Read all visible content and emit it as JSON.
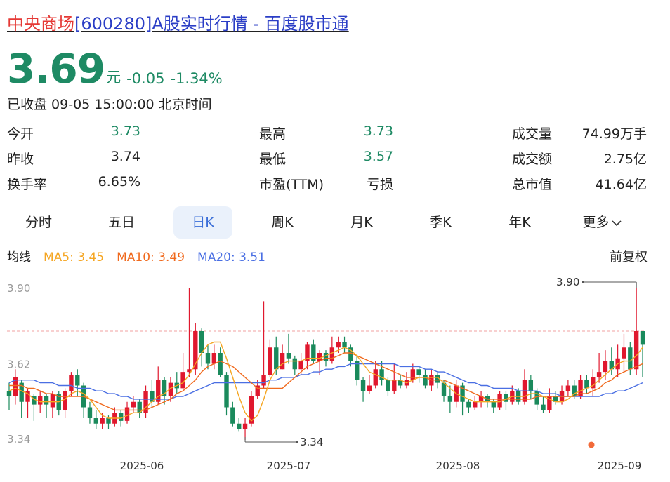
{
  "title": {
    "name": "中央商场",
    "rest": "[600280]A股实时行情 - 百度股市通"
  },
  "quote": {
    "price": "3.69",
    "unit": "元",
    "change": "-0.05",
    "change_pct": "-1.34%",
    "status": "已收盘 09-05 15:00:00 北京时间"
  },
  "stats": [
    [
      {
        "label": "今开",
        "value": "3.73",
        "tone": "green"
      },
      {
        "label": "最高",
        "value": "3.73",
        "tone": "green"
      },
      {
        "label": "成交量",
        "value": "74.99万手",
        "tone": "dark"
      }
    ],
    [
      {
        "label": "昨收",
        "value": "3.74",
        "tone": "dark"
      },
      {
        "label": "最低",
        "value": "3.57",
        "tone": "green"
      },
      {
        "label": "成交额",
        "value": "2.75亿",
        "tone": "dark"
      }
    ],
    [
      {
        "label": "换手率",
        "value": "6.65%",
        "tone": "dark"
      },
      {
        "label": "市盈(TTM)",
        "value": "亏损",
        "tone": "dark"
      },
      {
        "label": "总市值",
        "value": "41.64亿",
        "tone": "dark"
      }
    ]
  ],
  "tabs": [
    "分时",
    "五日",
    "日K",
    "周K",
    "月K",
    "季K",
    "年K",
    "更多"
  ],
  "active_tab": "日K",
  "ma": {
    "label": "均线",
    "ma5": "MA5: 3.45",
    "ma10": "MA10: 3.49",
    "ma20": "MA20: 3.51"
  },
  "adjust_label": "前复权",
  "colors": {
    "up": "#e0182e",
    "down": "#1a8a5c",
    "ma5": "#f5a623",
    "ma10": "#f06a1e",
    "ma20": "#4a6fe3",
    "ref_line": "#f2a1a1"
  },
  "chart_data": {
    "type": "candlestick",
    "y_ticks": [
      "3.90",
      "3.62",
      "3.34"
    ],
    "ylim": [
      3.34,
      3.9
    ],
    "x_ticks": [
      "2025-06",
      "2025-07",
      "2025-08",
      "2025-09"
    ],
    "high_label": "3.90",
    "low_label": "3.34",
    "prev_close": 3.74,
    "candles": [
      [
        3.52,
        3.5,
        3.55,
        3.45
      ],
      [
        3.5,
        3.57,
        3.6,
        3.47
      ],
      [
        3.55,
        3.48,
        3.56,
        3.42
      ],
      [
        3.48,
        3.52,
        3.53,
        3.42
      ],
      [
        3.5,
        3.47,
        3.51,
        3.41
      ],
      [
        3.47,
        3.5,
        3.52,
        3.44
      ],
      [
        3.5,
        3.47,
        3.51,
        3.42
      ],
      [
        3.46,
        3.51,
        3.52,
        3.42
      ],
      [
        3.51,
        3.45,
        3.52,
        3.43
      ],
      [
        3.45,
        3.52,
        3.53,
        3.42
      ],
      [
        3.52,
        3.58,
        3.59,
        3.5
      ],
      [
        3.58,
        3.54,
        3.6,
        3.5
      ],
      [
        3.54,
        3.46,
        3.55,
        3.42
      ],
      [
        3.46,
        3.42,
        3.48,
        3.4
      ],
      [
        3.42,
        3.4,
        3.45,
        3.38
      ],
      [
        3.4,
        3.42,
        3.44,
        3.38
      ],
      [
        3.42,
        3.4,
        3.43,
        3.38
      ],
      [
        3.4,
        3.44,
        3.46,
        3.39
      ],
      [
        3.44,
        3.41,
        3.45,
        3.39
      ],
      [
        3.41,
        3.46,
        3.48,
        3.4
      ],
      [
        3.46,
        3.48,
        3.5,
        3.44
      ],
      [
        3.48,
        3.44,
        3.49,
        3.42
      ],
      [
        3.44,
        3.52,
        3.54,
        3.42
      ],
      [
        3.52,
        3.48,
        3.56,
        3.46
      ],
      [
        3.48,
        3.56,
        3.61,
        3.47
      ],
      [
        3.56,
        3.5,
        3.57,
        3.47
      ],
      [
        3.5,
        3.55,
        3.57,
        3.48
      ],
      [
        3.55,
        3.53,
        3.59,
        3.51
      ],
      [
        3.53,
        3.59,
        3.66,
        3.52
      ],
      [
        3.59,
        3.6,
        3.9,
        3.57
      ],
      [
        3.6,
        3.74,
        3.77,
        3.58
      ],
      [
        3.74,
        3.66,
        3.75,
        3.61
      ],
      [
        3.66,
        3.62,
        3.69,
        3.6
      ],
      [
        3.62,
        3.66,
        3.69,
        3.6
      ],
      [
        3.66,
        3.58,
        3.68,
        3.57
      ],
      [
        3.58,
        3.46,
        3.59,
        3.43
      ],
      [
        3.46,
        3.4,
        3.48,
        3.39
      ],
      [
        3.4,
        3.38,
        3.42,
        3.37
      ],
      [
        3.38,
        3.4,
        3.42,
        3.34
      ],
      [
        3.4,
        3.5,
        3.52,
        3.39
      ],
      [
        3.5,
        3.54,
        3.56,
        3.49
      ],
      [
        3.54,
        3.58,
        3.85,
        3.53
      ],
      [
        3.58,
        3.68,
        3.71,
        3.57
      ],
      [
        3.68,
        3.6,
        3.72,
        3.58
      ],
      [
        3.6,
        3.66,
        3.69,
        3.6
      ],
      [
        3.66,
        3.64,
        3.73,
        3.62
      ],
      [
        3.64,
        3.6,
        3.65,
        3.58
      ],
      [
        3.6,
        3.63,
        3.66,
        3.58
      ],
      [
        3.63,
        3.69,
        3.7,
        3.6
      ],
      [
        3.69,
        3.63,
        3.71,
        3.62
      ],
      [
        3.63,
        3.66,
        3.67,
        3.58
      ],
      [
        3.66,
        3.63,
        3.67,
        3.61
      ],
      [
        3.63,
        3.68,
        3.72,
        3.62
      ],
      [
        3.68,
        3.7,
        3.72,
        3.66
      ],
      [
        3.7,
        3.68,
        3.72,
        3.66
      ],
      [
        3.68,
        3.63,
        3.69,
        3.61
      ],
      [
        3.63,
        3.56,
        3.65,
        3.54
      ],
      [
        3.56,
        3.52,
        3.57,
        3.48
      ],
      [
        3.52,
        3.54,
        3.58,
        3.51
      ],
      [
        3.54,
        3.6,
        3.63,
        3.53
      ],
      [
        3.6,
        3.56,
        3.63,
        3.54
      ],
      [
        3.56,
        3.52,
        3.57,
        3.5
      ],
      [
        3.52,
        3.56,
        3.62,
        3.51
      ],
      [
        3.56,
        3.54,
        3.58,
        3.53
      ],
      [
        3.54,
        3.56,
        3.59,
        3.53
      ],
      [
        3.56,
        3.6,
        3.62,
        3.55
      ],
      [
        3.6,
        3.58,
        3.61,
        3.55
      ],
      [
        3.58,
        3.54,
        3.6,
        3.53
      ],
      [
        3.54,
        3.58,
        3.6,
        3.52
      ],
      [
        3.58,
        3.55,
        3.59,
        3.53
      ],
      [
        3.55,
        3.5,
        3.56,
        3.48
      ],
      [
        3.5,
        3.48,
        3.54,
        3.44
      ],
      [
        3.48,
        3.54,
        3.56,
        3.46
      ],
      [
        3.54,
        3.48,
        3.55,
        3.43
      ],
      [
        3.48,
        3.46,
        3.49,
        3.44
      ],
      [
        3.46,
        3.48,
        3.5,
        3.45
      ],
      [
        3.48,
        3.5,
        3.52,
        3.46
      ],
      [
        3.5,
        3.48,
        3.51,
        3.46
      ],
      [
        3.48,
        3.46,
        3.49,
        3.44
      ],
      [
        3.46,
        3.51,
        3.52,
        3.45
      ],
      [
        3.51,
        3.48,
        3.52,
        3.45
      ],
      [
        3.48,
        3.52,
        3.54,
        3.47
      ],
      [
        3.52,
        3.48,
        3.53,
        3.47
      ],
      [
        3.48,
        3.56,
        3.6,
        3.47
      ],
      [
        3.56,
        3.52,
        3.58,
        3.49
      ],
      [
        3.52,
        3.47,
        3.53,
        3.45
      ],
      [
        3.47,
        3.45,
        3.5,
        3.44
      ],
      [
        3.45,
        3.5,
        3.53,
        3.44
      ],
      [
        3.5,
        3.48,
        3.52,
        3.47
      ],
      [
        3.48,
        3.52,
        3.54,
        3.47
      ],
      [
        3.52,
        3.54,
        3.56,
        3.5
      ],
      [
        3.54,
        3.5,
        3.56,
        3.49
      ],
      [
        3.5,
        3.56,
        3.58,
        3.49
      ],
      [
        3.56,
        3.53,
        3.58,
        3.51
      ],
      [
        3.53,
        3.57,
        3.6,
        3.5
      ],
      [
        3.57,
        3.59,
        3.66,
        3.55
      ],
      [
        3.59,
        3.63,
        3.67,
        3.56
      ],
      [
        3.63,
        3.6,
        3.68,
        3.58
      ],
      [
        3.6,
        3.64,
        3.69,
        3.57
      ],
      [
        3.64,
        3.68,
        3.73,
        3.59
      ],
      [
        3.68,
        3.6,
        3.7,
        3.58
      ],
      [
        3.6,
        3.74,
        3.9,
        3.58
      ],
      [
        3.74,
        3.69,
        3.73,
        3.57
      ]
    ],
    "ma5": [
      3.52,
      3.53,
      3.52,
      3.51,
      3.49,
      3.48,
      3.48,
      3.48,
      3.48,
      3.49,
      3.51,
      3.52,
      3.51,
      3.49,
      3.46,
      3.43,
      3.42,
      3.42,
      3.42,
      3.43,
      3.44,
      3.44,
      3.46,
      3.48,
      3.5,
      3.51,
      3.53,
      3.54,
      3.55,
      3.58,
      3.62,
      3.66,
      3.69,
      3.7,
      3.7,
      3.64,
      3.57,
      3.5,
      3.44,
      3.41,
      3.43,
      3.49,
      3.56,
      3.6,
      3.62,
      3.63,
      3.63,
      3.63,
      3.64,
      3.64,
      3.64,
      3.65,
      3.66,
      3.67,
      3.68,
      3.67,
      3.65,
      3.62,
      3.59,
      3.58,
      3.57,
      3.56,
      3.56,
      3.56,
      3.55,
      3.56,
      3.57,
      3.57,
      3.57,
      3.57,
      3.55,
      3.53,
      3.51,
      3.5,
      3.49,
      3.48,
      3.48,
      3.48,
      3.48,
      3.48,
      3.49,
      3.5,
      3.5,
      3.5,
      3.51,
      3.51,
      3.5,
      3.49,
      3.48,
      3.48,
      3.49,
      3.51,
      3.52,
      3.53,
      3.54,
      3.56,
      3.58,
      3.6,
      3.62,
      3.63,
      3.63,
      3.65,
      3.68
    ],
    "ma10": [
      3.54,
      3.54,
      3.54,
      3.53,
      3.53,
      3.52,
      3.51,
      3.51,
      3.5,
      3.5,
      3.5,
      3.5,
      3.5,
      3.49,
      3.48,
      3.47,
      3.46,
      3.45,
      3.45,
      3.45,
      3.45,
      3.45,
      3.45,
      3.46,
      3.47,
      3.48,
      3.49,
      3.51,
      3.52,
      3.54,
      3.56,
      3.59,
      3.61,
      3.62,
      3.63,
      3.62,
      3.61,
      3.59,
      3.57,
      3.55,
      3.53,
      3.53,
      3.53,
      3.53,
      3.53,
      3.55,
      3.57,
      3.59,
      3.61,
      3.62,
      3.63,
      3.64,
      3.64,
      3.65,
      3.66,
      3.66,
      3.65,
      3.64,
      3.63,
      3.62,
      3.61,
      3.6,
      3.59,
      3.58,
      3.57,
      3.57,
      3.57,
      3.57,
      3.56,
      3.56,
      3.56,
      3.55,
      3.54,
      3.53,
      3.52,
      3.51,
      3.5,
      3.49,
      3.49,
      3.49,
      3.49,
      3.49,
      3.49,
      3.49,
      3.49,
      3.5,
      3.5,
      3.5,
      3.5,
      3.5,
      3.5,
      3.5,
      3.51,
      3.51,
      3.52,
      3.53,
      3.55,
      3.56,
      3.58,
      3.59,
      3.6,
      3.61,
      3.62
    ],
    "ma20": [
      3.55,
      3.56,
      3.56,
      3.56,
      3.56,
      3.55,
      3.55,
      3.55,
      3.54,
      3.54,
      3.54,
      3.53,
      3.53,
      3.53,
      3.52,
      3.52,
      3.51,
      3.51,
      3.5,
      3.5,
      3.49,
      3.49,
      3.49,
      3.49,
      3.49,
      3.49,
      3.49,
      3.5,
      3.5,
      3.51,
      3.52,
      3.53,
      3.54,
      3.55,
      3.55,
      3.55,
      3.55,
      3.55,
      3.55,
      3.55,
      3.55,
      3.55,
      3.56,
      3.56,
      3.57,
      3.57,
      3.57,
      3.58,
      3.58,
      3.59,
      3.59,
      3.6,
      3.6,
      3.61,
      3.61,
      3.62,
      3.62,
      3.62,
      3.62,
      3.62,
      3.62,
      3.62,
      3.62,
      3.61,
      3.61,
      3.61,
      3.61,
      3.6,
      3.6,
      3.59,
      3.59,
      3.58,
      3.57,
      3.56,
      3.55,
      3.55,
      3.54,
      3.54,
      3.53,
      3.53,
      3.53,
      3.53,
      3.52,
      3.52,
      3.52,
      3.52,
      3.51,
      3.51,
      3.51,
      3.5,
      3.5,
      3.5,
      3.5,
      3.5,
      3.5,
      3.5,
      3.51,
      3.51,
      3.52,
      3.52,
      3.53,
      3.54,
      3.55
    ]
  }
}
